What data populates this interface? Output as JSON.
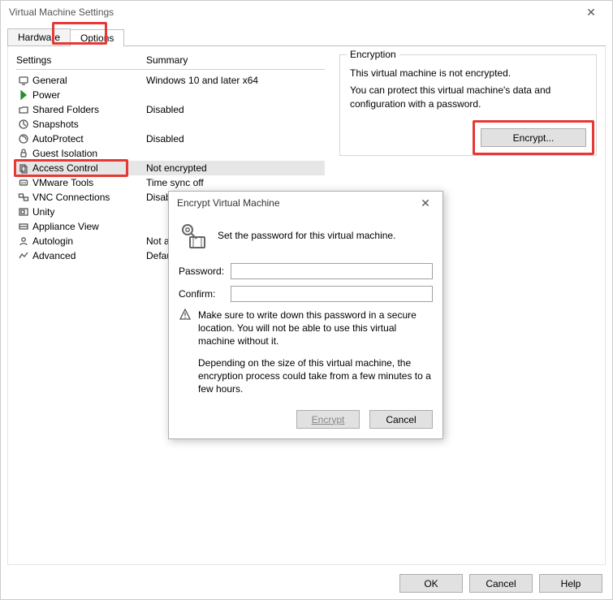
{
  "window": {
    "title": "Virtual Machine Settings",
    "buttons": {
      "ok": "OK",
      "cancel": "Cancel",
      "help": "Help"
    }
  },
  "tabs": {
    "hardware": "Hardware",
    "options": "Options"
  },
  "list": {
    "headings": {
      "settings": "Settings",
      "summary": "Summary"
    },
    "items": [
      {
        "id": "general",
        "label": "General",
        "summary": "Windows 10 and later x64",
        "selected": false
      },
      {
        "id": "power",
        "label": "Power",
        "summary": "",
        "selected": false
      },
      {
        "id": "shared-folders",
        "label": "Shared Folders",
        "summary": "Disabled",
        "selected": false
      },
      {
        "id": "snapshots",
        "label": "Snapshots",
        "summary": "",
        "selected": false
      },
      {
        "id": "autoprotect",
        "label": "AutoProtect",
        "summary": "Disabled",
        "selected": false
      },
      {
        "id": "guest-isolation",
        "label": "Guest Isolation",
        "summary": "",
        "selected": false
      },
      {
        "id": "access-control",
        "label": "Access Control",
        "summary": "Not encrypted",
        "selected": true
      },
      {
        "id": "vmware-tools",
        "label": "VMware Tools",
        "summary": "Time sync off",
        "selected": false
      },
      {
        "id": "vnc-connections",
        "label": "VNC Connections",
        "summary": "Disabled",
        "selected": false
      },
      {
        "id": "unity",
        "label": "Unity",
        "summary": "",
        "selected": false
      },
      {
        "id": "appliance-view",
        "label": "Appliance View",
        "summary": "",
        "selected": false
      },
      {
        "id": "autologin",
        "label": "Autologin",
        "summary": "Not avail",
        "selected": false
      },
      {
        "id": "advanced",
        "label": "Advanced",
        "summary": "Default/D",
        "selected": false
      }
    ]
  },
  "encryption": {
    "legend": "Encryption",
    "status": "This virtual machine is not encrypted.",
    "hint": "You can protect this virtual machine's data and configuration with a password.",
    "button": "Encrypt..."
  },
  "dialog": {
    "title": "Encrypt Virtual Machine",
    "intro": "Set the password for this virtual machine.",
    "labels": {
      "password": "Password:",
      "confirm": "Confirm:"
    },
    "fields": {
      "password": "",
      "confirm": ""
    },
    "warning": "Make sure to write down this password in a secure location. You will not be able to use this virtual machine without it.",
    "note": "Depending on the size of this virtual machine, the encryption process could take from a few minutes to a few hours.",
    "buttons": {
      "encrypt": "Encrypt",
      "cancel": "Cancel"
    }
  },
  "highlight_color": "#e53935"
}
